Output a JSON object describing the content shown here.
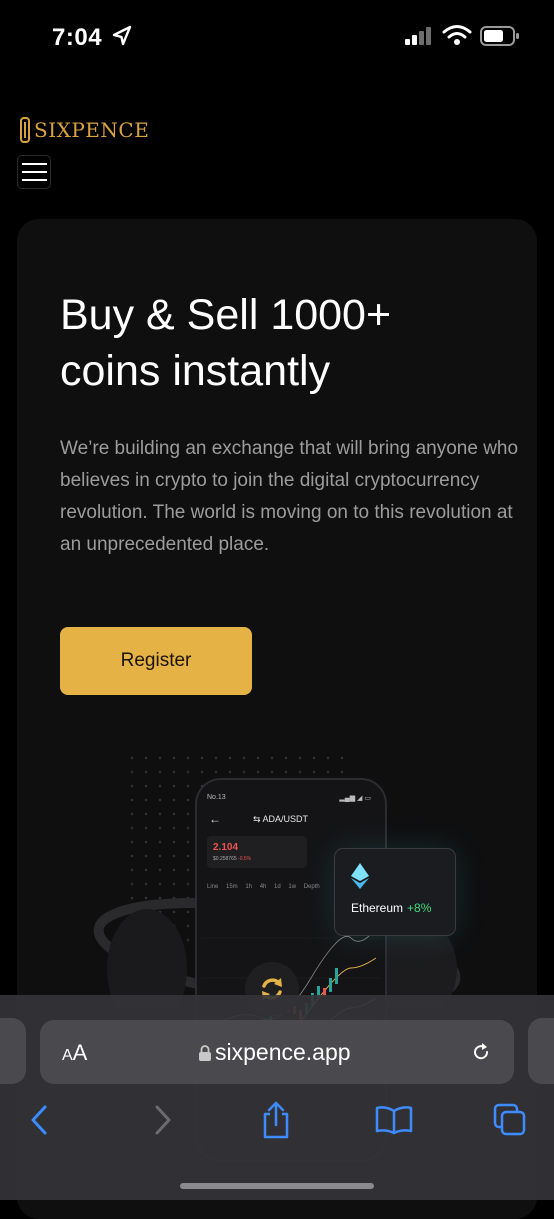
{
  "status_bar": {
    "time": "7:04",
    "icons": [
      "location-arrow-icon",
      "cellular-signal-icon",
      "wifi-icon",
      "battery-icon"
    ]
  },
  "site": {
    "logo_text": "SIXPENCE",
    "menu_icon": "hamburger-menu-icon"
  },
  "hero": {
    "title_line1": "Buy & Sell 1000+",
    "title_line2": "coins instantly",
    "description": "We’re building an exchange that will bring anyone who believes in crypto to join the digital cryptocurrency revolution. The world is moving on to this revolution at an unprecedented place.",
    "register_label": "Register"
  },
  "phone_mockup": {
    "carrier": "No.13",
    "pair": "ADA/USDT",
    "price": "2.104",
    "sub_price": "$0.258765",
    "sub_change": "-0.5%",
    "tabs": "Line 15m 1h 4h 1d 1w Depth"
  },
  "ethereum_card": {
    "name": "Ethereum",
    "change": "+8%"
  },
  "browser": {
    "aa_label": "AA",
    "url": "sixpence.app",
    "nav_icons": [
      "back-icon",
      "forward-icon",
      "share-icon",
      "bookmarks-icon",
      "tabs-icon"
    ]
  },
  "colors": {
    "accent": "#e5b245",
    "logo": "#d9a440",
    "positive": "#3fdc7a",
    "ios_blue": "#3d8bff"
  }
}
